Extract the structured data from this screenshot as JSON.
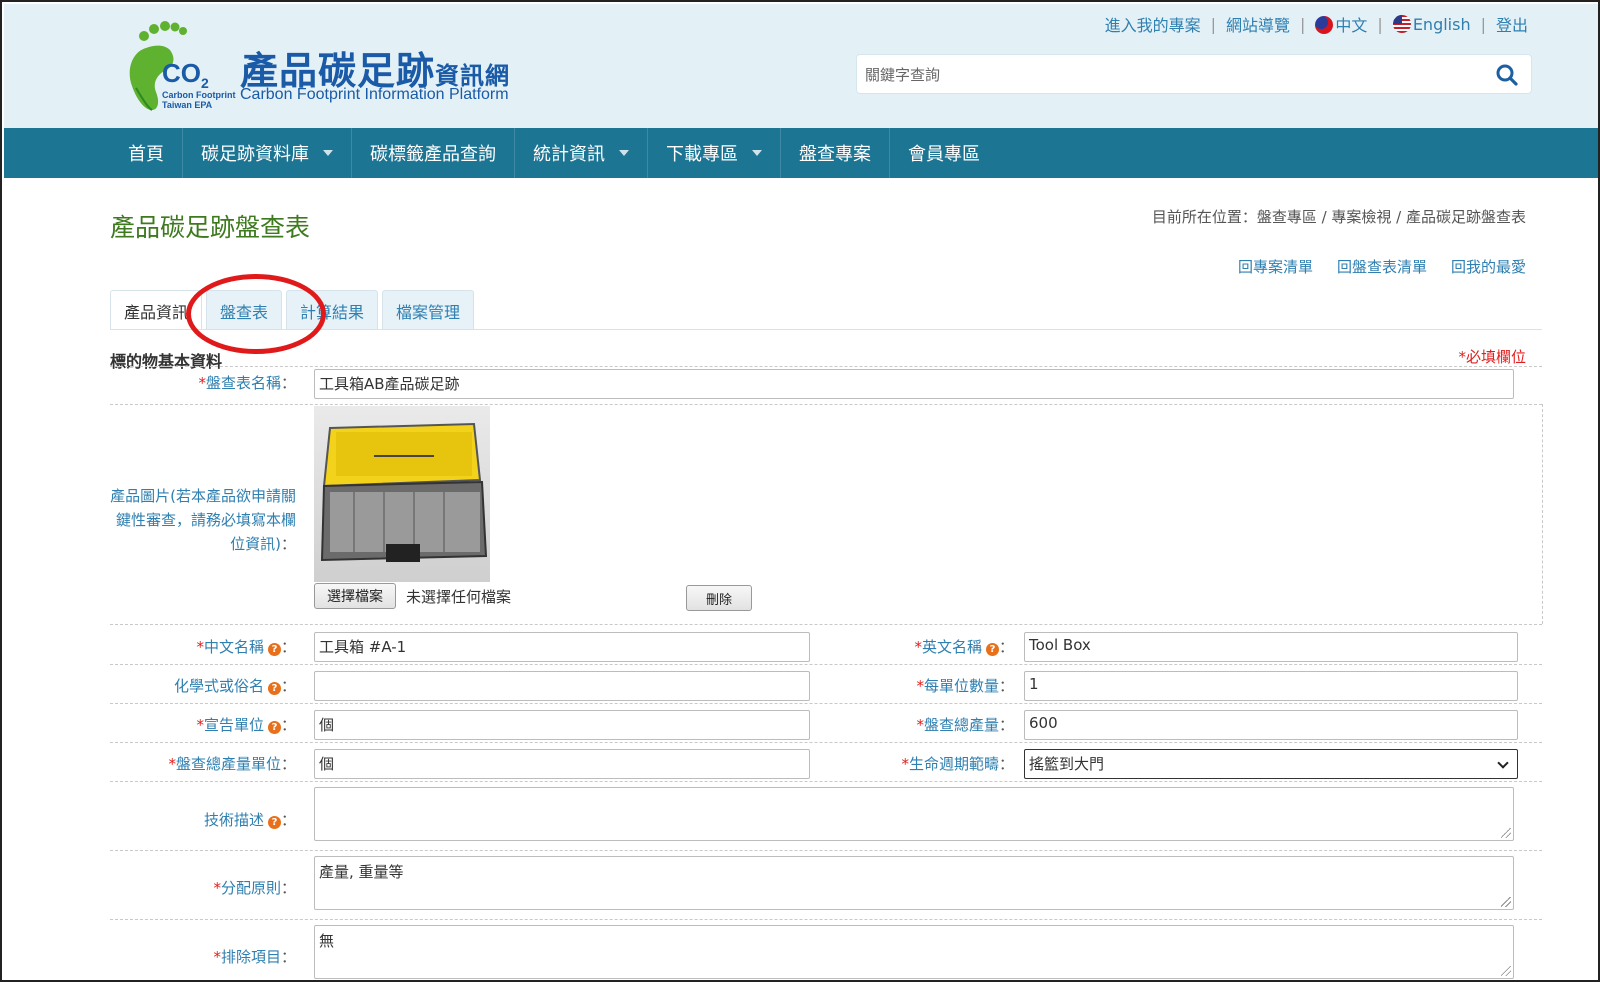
{
  "header": {
    "logo_co2": "CO",
    "logo_co2_sub": "2",
    "logo_small_1": "Carbon Footprint",
    "logo_small_2": "Taiwan EPA",
    "logo_title": "產品碳足跡",
    "logo_title_small": "資訊網",
    "logo_subtitle": "Carbon Footprint Information Platform",
    "links": {
      "my_projects": "進入我的專案",
      "site_map": "網站導覽",
      "chinese": "中文",
      "english": "English",
      "logout": "登出"
    },
    "search_placeholder": "關鍵字查詢"
  },
  "nav": [
    {
      "label": "首頁",
      "dropdown": false
    },
    {
      "label": "碳足跡資料庫",
      "dropdown": true
    },
    {
      "label": "碳標籤產品查詢",
      "dropdown": false
    },
    {
      "label": "統計資訊",
      "dropdown": true
    },
    {
      "label": "下載專區",
      "dropdown": true
    },
    {
      "label": "盤查專案",
      "dropdown": false
    },
    {
      "label": "會員專區",
      "dropdown": false
    }
  ],
  "page": {
    "title": "產品碳足跡盤查表",
    "breadcrumb": "目前所在位置：盤查專區 / 專案檢視 / 產品碳足跡盤查表",
    "quicklinks": {
      "project_list": "回專案清單",
      "inventory_list": "回盤查表清單",
      "favorites": "回我的最愛"
    },
    "tabs": {
      "product_info": "產品資訊",
      "inventory": "盤查表",
      "results": "計算結果",
      "files": "檔案管理"
    },
    "section_title": "標的物基本資料",
    "required_note": "*必填欄位"
  },
  "form": {
    "sheet_name": {
      "label": "盤查表名稱",
      "value": "工具箱AB產品碳足跡"
    },
    "photo": {
      "label": "產品圖片(若本產品欲申請關鍵性審查，請務必填寫本欄位資訊)",
      "choose_button": "選擇檔案",
      "no_file": "未選擇任何檔案",
      "delete_button": "刪除"
    },
    "zh_name": {
      "label": "中文名稱",
      "value": "工具箱 #A-1"
    },
    "en_name": {
      "label": "英文名稱",
      "value": "Tool Box"
    },
    "chem_name": {
      "label": "化學式或俗名",
      "value": ""
    },
    "per_unit_qty": {
      "label": "每單位數量",
      "value": "1"
    },
    "declared_unit": {
      "label": "宣告單位",
      "value": "個"
    },
    "total_output": {
      "label": "盤查總產量",
      "value": "600"
    },
    "total_output_unit": {
      "label": "盤查總產量單位",
      "value": "個"
    },
    "life_cycle": {
      "label": "生命週期範疇",
      "value": "搖籃到大門"
    },
    "tech_desc": {
      "label": "技術描述",
      "value": ""
    },
    "allocation": {
      "label": "分配原則",
      "value": "產量, 重量等"
    },
    "exclusion": {
      "label": "排除項目",
      "value": "無"
    }
  },
  "colors": {
    "nav_bg": "#1d7594",
    "header_bg": "#e3f1f7",
    "title_green": "#3d7a1e",
    "link_blue": "#2f7fb0",
    "required_red": "#e02020",
    "annotation_red": "#e01a1a"
  }
}
